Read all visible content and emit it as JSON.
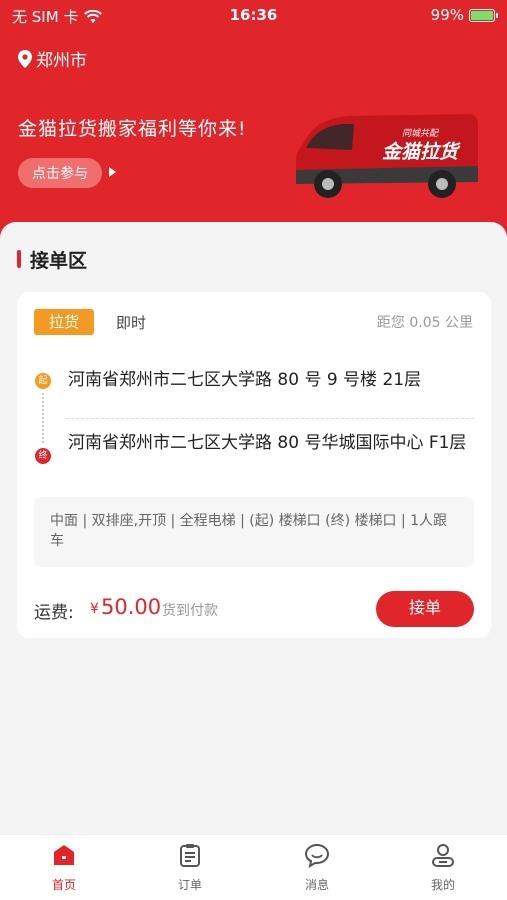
{
  "status_bar": {
    "carrier": "无 SIM 卡",
    "time": "16:36",
    "battery": "99%"
  },
  "header": {
    "city": "郑州市",
    "promo": "金猫拉货搬家福利等你来!",
    "join_label": "点击参与",
    "van_text": "金猫拉货",
    "van_subtext": "同城共配",
    "brand_color": "#e0262a"
  },
  "section": {
    "title": "接单区"
  },
  "order": {
    "type_tag": "拉货",
    "time_tag": "即时",
    "distance": "距您 0.05 公里",
    "start_marker": "起",
    "end_marker": "终",
    "start_address": "河南省郑州市二七区大学路 80 号 9 号楼 21层",
    "end_address": "河南省郑州市二七区大学路 80 号华城国际中心 F1层",
    "details": "中面 | 双排座,开顶 | 全程电梯 | (起) 楼梯口 (终) 楼梯口 | 1人跟车",
    "fee_label": "运费:",
    "fee_currency": "¥",
    "fee_amount": "50.00",
    "fee_note": "货到付款",
    "accept_label": "接单"
  },
  "tabs": [
    {
      "label": "首页",
      "icon": "home-icon"
    },
    {
      "label": "订单",
      "icon": "order-list-icon"
    },
    {
      "label": "消息",
      "icon": "message-icon"
    },
    {
      "label": "我的",
      "icon": "profile-icon"
    }
  ]
}
